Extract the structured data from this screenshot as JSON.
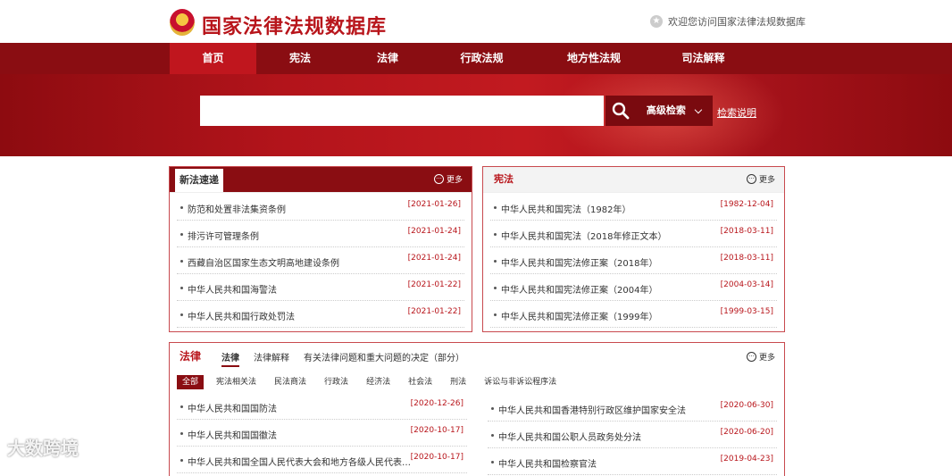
{
  "header": {
    "title": "国家法律法规数据库",
    "welcome": "欢迎您访问国家法律法规数据库"
  },
  "nav": [
    {
      "label": "首页",
      "active": true
    },
    {
      "label": "宪法"
    },
    {
      "label": "法律"
    },
    {
      "label": "行政法规"
    },
    {
      "label": "地方性法规"
    },
    {
      "label": "司法解释"
    }
  ],
  "search": {
    "placeholder": "",
    "advanced_label": "高级检索",
    "help_label": "检索说明"
  },
  "new_laws": {
    "tab": "新法速递",
    "more": "更多",
    "items": [
      {
        "title": "防范和处置非法集资条例",
        "date": "[2021-01-26]"
      },
      {
        "title": "排污许可管理条例",
        "date": "[2021-01-24]"
      },
      {
        "title": "西藏自治区国家生态文明高地建设条例",
        "date": "[2021-01-24]"
      },
      {
        "title": "中华人民共和国海警法",
        "date": "[2021-01-22]"
      },
      {
        "title": "中华人民共和国行政处罚法",
        "date": "[2021-01-22]"
      }
    ]
  },
  "constitution": {
    "title": "宪法",
    "more": "更多",
    "items": [
      {
        "title": "中华人民共和国宪法（1982年）",
        "date": "[1982-12-04]"
      },
      {
        "title": "中华人民共和国宪法（2018年修正文本）",
        "date": "[2018-03-11]"
      },
      {
        "title": "中华人民共和国宪法修正案（2018年）",
        "date": "[2018-03-11]"
      },
      {
        "title": "中华人民共和国宪法修正案（2004年）",
        "date": "[2004-03-14]"
      },
      {
        "title": "中华人民共和国宪法修正案（1999年）",
        "date": "[1999-03-15]"
      }
    ]
  },
  "laws": {
    "title": "法律",
    "more": "更多",
    "tabs": [
      "法律",
      "法律解释",
      "有关法律问题和重大问题的决定（部分）"
    ],
    "filters": [
      "全部",
      "宪法相关法",
      "民法商法",
      "行政法",
      "经济法",
      "社会法",
      "刑法",
      "诉讼与非诉讼程序法"
    ],
    "left_items": [
      {
        "title": "中华人民共和国国防法",
        "date": "[2020-12-26]"
      },
      {
        "title": "中华人民共和国国徽法",
        "date": "[2020-10-17]"
      },
      {
        "title": "中华人民共和国全国人民代表大会和地方各级人民代表…",
        "date": "[2020-10-17]"
      }
    ],
    "right_items": [
      {
        "title": "中华人民共和国香港特别行政区维护国家安全法",
        "date": "[2020-06-30]"
      },
      {
        "title": "中华人民共和国公职人员政务处分法",
        "date": "[2020-06-20]"
      },
      {
        "title": "中华人民共和国检察官法",
        "date": "[2019-04-23]"
      }
    ]
  },
  "watermark": "大数跨境"
}
